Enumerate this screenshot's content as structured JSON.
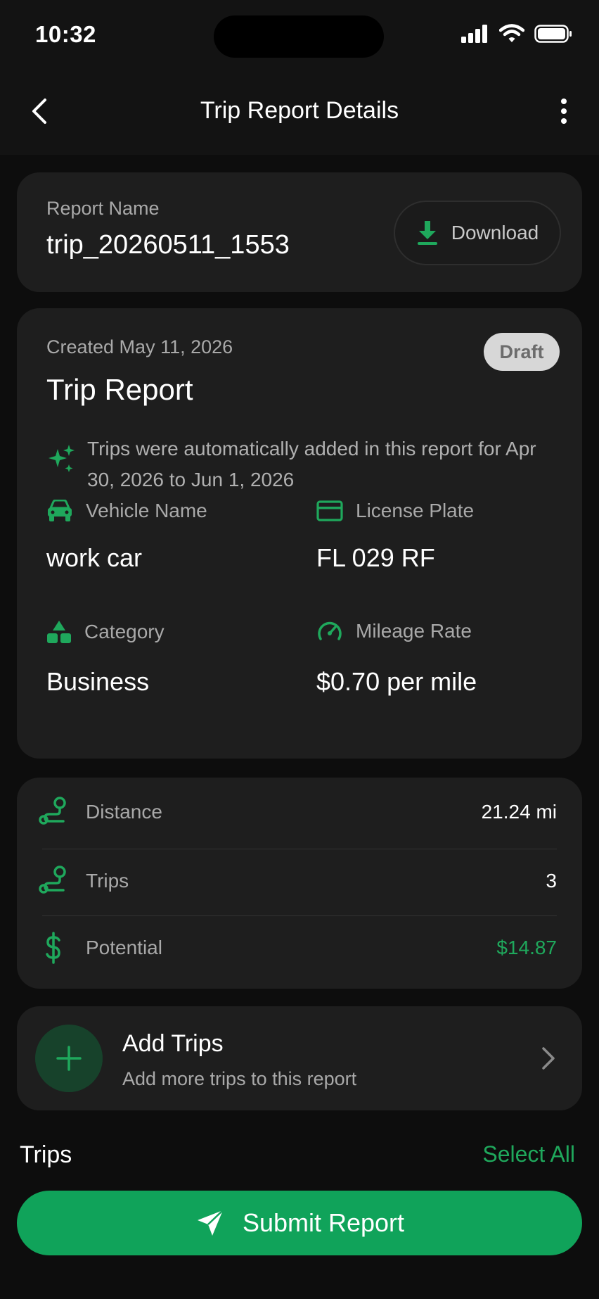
{
  "status_bar": {
    "time": "10:32"
  },
  "header": {
    "title": "Trip Report Details"
  },
  "report": {
    "name_label": "Report Name",
    "name": "trip_20260511_1553",
    "download_label": "Download"
  },
  "details": {
    "created": "Created May 11, 2026",
    "status_badge": "Draft",
    "title": "Trip Report",
    "auto_note": "Trips were automatically added in this report for Apr 30, 2026 to Jun 1, 2026",
    "vehicle_label": "Vehicle Name",
    "vehicle_value": "work car",
    "plate_label": "License Plate",
    "plate_value": "FL 029 RF",
    "category_label": "Category",
    "category_value": "Business",
    "rate_label": "Mileage Rate",
    "rate_value": "$0.70 per mile"
  },
  "summary": {
    "distance_label": "Distance",
    "distance_value": "21.24 mi",
    "trips_label": "Trips",
    "trips_value": "3",
    "potential_label": "Potential",
    "potential_value": "$14.87"
  },
  "add_trips": {
    "title": "Add Trips",
    "subtitle": "Add more trips to this report"
  },
  "trips_section": {
    "title": "Trips",
    "select_all": "Select All"
  },
  "submit_label": "Submit Report",
  "colors": {
    "accent": "#1fa85c",
    "button": "#10a35a",
    "card": "#1e1e1e",
    "background": "#0d0d0d"
  }
}
